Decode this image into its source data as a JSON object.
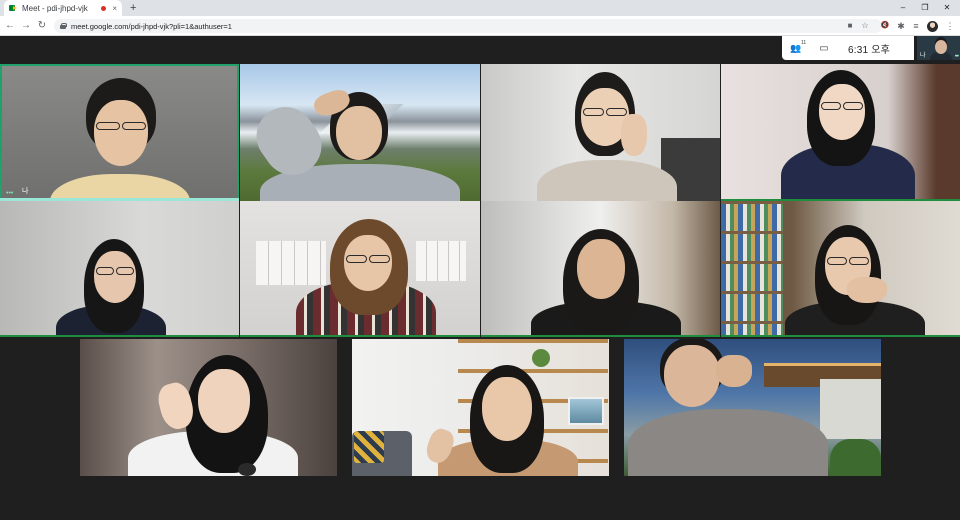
{
  "browser": {
    "tab_title": "Meet - pdi-jhpd-vjk",
    "tab_close": "×",
    "new_tab": "+",
    "url": "meet.google.com/pdi-jhpd-vjk?pli=1&authuser=1",
    "window_minimize": "–",
    "window_restore": "❐",
    "window_close": "✕",
    "back_icon": "arrow-left",
    "forward_icon": "arrow-right",
    "reload_icon": "reload",
    "back_glyph": "←",
    "forward_glyph": "→",
    "reload_glyph": "↻",
    "camera_glyph": "■",
    "star_glyph": "☆",
    "mute_glyph": "🔇",
    "extensions_glyph": "✱",
    "media_glyph": "≡",
    "menu_glyph": "⋮"
  },
  "meet": {
    "people_count": "11",
    "people_glyph": "👥",
    "chat_glyph": "▭",
    "clock": "6:31 오후",
    "self_name": "나",
    "self_more": "•••"
  },
  "tiles": [
    {
      "name_label": "나",
      "speaking_dots": "•••",
      "state": "speaking"
    },
    {
      "name_label": "",
      "state": "normal"
    },
    {
      "name_label": "",
      "state": "normal"
    },
    {
      "name_label": "",
      "state": "active-bottom"
    },
    {
      "name_label": "",
      "state": "active-bottom"
    },
    {
      "name_label": "",
      "state": "active-bottom"
    },
    {
      "name_label": "",
      "state": "active-bottom"
    },
    {
      "name_label": "",
      "state": "active-bottom"
    },
    {
      "name_label": "",
      "state": "normal"
    },
    {
      "name_label": "",
      "state": "normal"
    },
    {
      "name_label": "",
      "state": "normal"
    }
  ],
  "colors": {
    "speaking_green": "#22a06b",
    "active_green": "#1e8e3e",
    "meet_background": "#1f1f1f"
  }
}
